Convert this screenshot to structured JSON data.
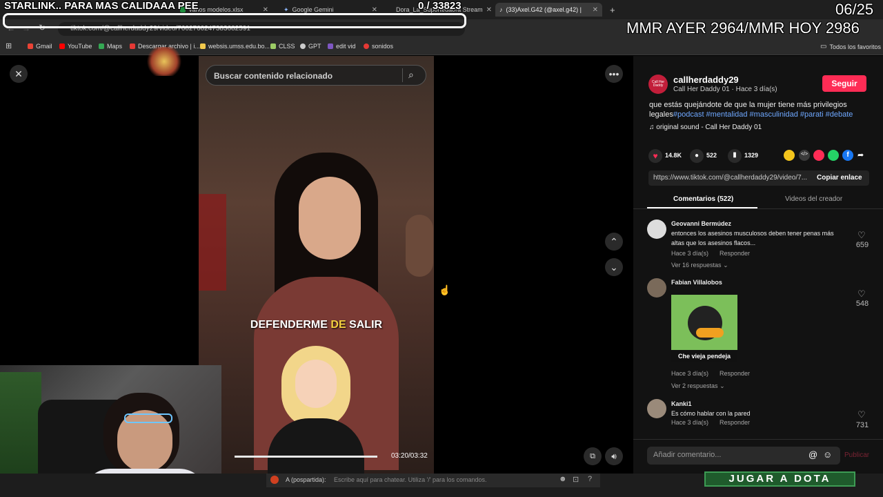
{
  "tabs": [
    {
      "title": "varios modelos.xlsx",
      "icon": "sheets-icon"
    },
    {
      "title": "Google Gemini",
      "icon": "gemini-icon"
    },
    {
      "title": "Dora_La_Suportedaora Stream",
      "icon": "sheets-icon"
    },
    {
      "title": "(33)Axel.G42 (@axel.g42) |",
      "icon": "tiktok-icon"
    }
  ],
  "address": "tiktok.com/@callherdaddy29/video/7602760247383682591",
  "bookmarks": [
    {
      "label": "Gmail",
      "color": "#ea4335"
    },
    {
      "label": "YouTube",
      "color": "#ff0000"
    },
    {
      "label": "Maps",
      "color": "#34a853"
    },
    {
      "label": "Descargar archivo | i...",
      "color": "#e53935"
    },
    {
      "label": "websis.umss.edu.bo...",
      "color": "#f2c94c"
    },
    {
      "label": "CLSS",
      "color": "#9ccc65"
    },
    {
      "label": "GPT",
      "color": "#cccccc"
    },
    {
      "label": "edit vid",
      "color": "#7e57c2"
    },
    {
      "label": "sonidos",
      "color": "#e53935"
    }
  ],
  "bookmarks_all": "Todos los favoritos",
  "overlay": {
    "starlink": "STARLINK.. PARA MAS CALIDAAA PEE",
    "counter": "0 / 33823",
    "date": "06/25",
    "mmr": "MMR AYER 2964/MMR HOY 2986"
  },
  "search": {
    "placeholder": "Buscar contenido relacionado"
  },
  "caption": {
    "word1": "DEFENDERME",
    "word2": "DE",
    "word3": "SALIR"
  },
  "video": {
    "timecode": "03:20/03:32",
    "progress": 0.94
  },
  "creator": {
    "handle": "callherdaddy29",
    "subtitle": "Call Her Daddy 01 · Hace 3 día(s)",
    "follow": "Seguir",
    "avatar_text": "Call Her Daddy"
  },
  "description": {
    "text": "que estás quejándote de que la mujer tiene más privilegios legales",
    "hashtags": "#podcast #mentalidad #masculinidad #parati #debate",
    "sound": "original sound - Call Her Daddy 01"
  },
  "stats": {
    "likes": "14.8K",
    "comments": "522",
    "saves": "1329"
  },
  "link": {
    "url": "https://www.tiktok.com/@callherdaddy29/video/7...",
    "copy": "Copiar enlace"
  },
  "panel_tabs": {
    "comments": "Comentarios (522)",
    "videos": "Videos del creador"
  },
  "comments": [
    {
      "user": "Geovanni Bermúdez",
      "text1": "entonces los asesinos musculosos deben tener penas más",
      "text2": "altas que los asesinos flacos...",
      "meta": "Hace 3 día(s)",
      "reply": "Responder",
      "likes": "659",
      "more": "Ver 16 respuestas"
    },
    {
      "user": "Fabian Villalobos",
      "image_caption": "Che vieja pendeja",
      "meta": "Hace 3 día(s)",
      "reply": "Responder",
      "likes": "548",
      "more": "Ver 2 respuestas"
    },
    {
      "user": "Kanki1",
      "text1": "Es cómo hablar con la pared",
      "meta": "Hace 3 día(s)",
      "reply": "Responder",
      "likes": "731"
    }
  ],
  "comment_input": {
    "placeholder": "Añadir comentario...",
    "post": "Publicar"
  },
  "chat": {
    "user": "A (pospartida):",
    "placeholder": "Escribe aquí para chatear. Utiliza '/' para los comandos."
  },
  "dota": "JUGAR A DOTA"
}
